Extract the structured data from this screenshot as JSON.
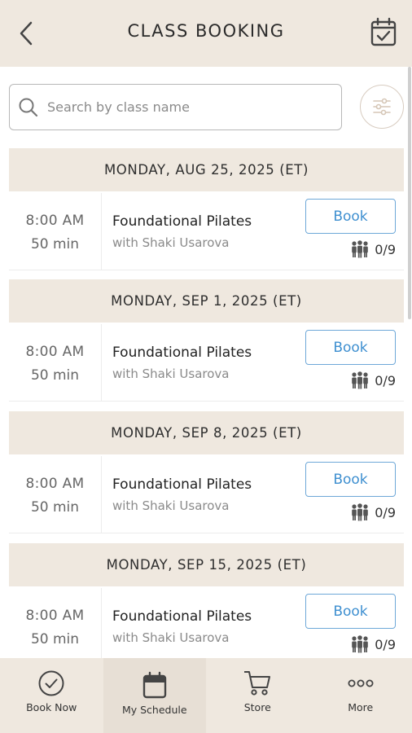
{
  "header": {
    "title": "CLASS BOOKING"
  },
  "search": {
    "placeholder": "Search by class name"
  },
  "sections": [
    {
      "date": "MONDAY, AUG 25, 2025 (ET)",
      "class": {
        "time": "8:00  AM",
        "duration": "50 min",
        "name": "Foundational Pilates",
        "instructor": "with Shaki Usarova",
        "book_label": "Book",
        "capacity": "0/9"
      }
    },
    {
      "date": "MONDAY, SEP 1, 2025 (ET)",
      "class": {
        "time": "8:00  AM",
        "duration": "50 min",
        "name": "Foundational Pilates",
        "instructor": "with Shaki Usarova",
        "book_label": "Book",
        "capacity": "0/9"
      }
    },
    {
      "date": "MONDAY, SEP 8, 2025 (ET)",
      "class": {
        "time": "8:00  AM",
        "duration": "50 min",
        "name": "Foundational Pilates",
        "instructor": "with Shaki Usarova",
        "book_label": "Book",
        "capacity": "0/9"
      }
    },
    {
      "date": "MONDAY, SEP 15, 2025 (ET)",
      "class": {
        "time": "8:00  AM",
        "duration": "50 min",
        "name": "Foundational Pilates",
        "instructor": "with Shaki Usarova",
        "book_label": "Book",
        "capacity": "0/9"
      }
    }
  ],
  "tabbar": {
    "tabs": [
      {
        "label": "Book Now",
        "icon": "check-circle-icon"
      },
      {
        "label": "My Schedule",
        "icon": "calendar-icon"
      },
      {
        "label": "Store",
        "icon": "cart-icon"
      },
      {
        "label": "More",
        "icon": "more-dots-icon"
      }
    ]
  },
  "colors": {
    "header_bg": "#efe8df",
    "accent_blue": "#3e8fd0"
  }
}
